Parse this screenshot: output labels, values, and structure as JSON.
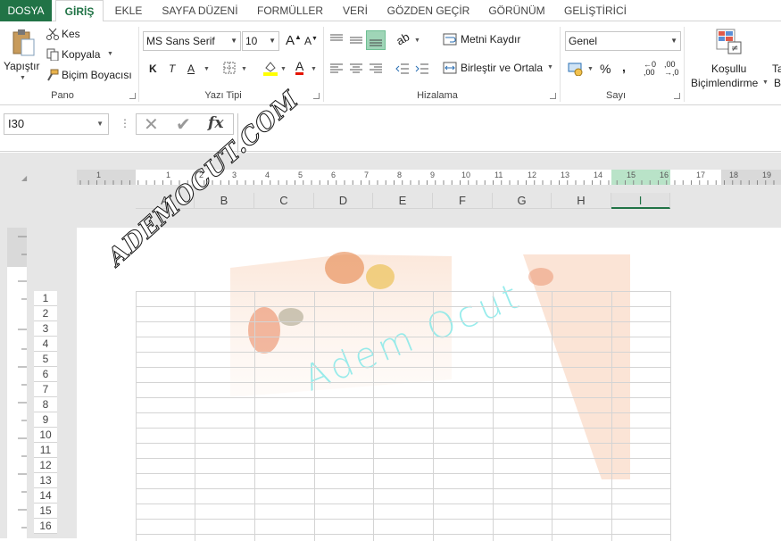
{
  "tabs": [
    "DOSYA",
    "GİRİŞ",
    "EKLE",
    "SAYFA DÜZENİ",
    "FORMÜLLER",
    "VERİ",
    "GÖZDEN GEÇİR",
    "GÖRÜNÜM",
    "GELİŞTİRİCİ"
  ],
  "clipboard": {
    "paste": "Yapıştır",
    "cut": "Kes",
    "copy": "Kopyala",
    "format_painter": "Biçim Boyacısı",
    "label": "Pano"
  },
  "font": {
    "name": "MS Sans Serif",
    "size": "10",
    "bold": "K",
    "italic": "T",
    "underline": "A",
    "label": "Yazı Tipi"
  },
  "alignment": {
    "wrap": "Metni Kaydır",
    "merge": "Birleştir ve Ortala",
    "label": "Hizalama"
  },
  "number": {
    "format": "Genel",
    "percent": "%",
    "comma": ",",
    "label": "Sayı"
  },
  "styles": {
    "cond_line1": "Koşullu",
    "cond_line2": "Biçimlendirme",
    "next_line1": "Ta",
    "next_line2": "Bi"
  },
  "formula_bar": {
    "name_box": "I30",
    "fx": "fx"
  },
  "ruler": {
    "marks": [
      "1",
      "1",
      "2",
      "3",
      "4",
      "5",
      "6",
      "7",
      "8",
      "9",
      "10",
      "11",
      "12",
      "13",
      "14",
      "15",
      "16",
      "17",
      "18",
      "19"
    ]
  },
  "columns": [
    "A",
    "B",
    "C",
    "D",
    "E",
    "F",
    "G",
    "H",
    "I"
  ],
  "rows": [
    "1",
    "2",
    "3",
    "4",
    "5",
    "6",
    "7",
    "8",
    "9",
    "10",
    "11",
    "12",
    "13",
    "14",
    "15",
    "16"
  ],
  "selected_column": "I",
  "watermark_text": "Adem Ocut",
  "logo_text": "ADEMOCUT.COM",
  "colors": {
    "accent": "#217346",
    "watermark": "#7fe8e8"
  }
}
